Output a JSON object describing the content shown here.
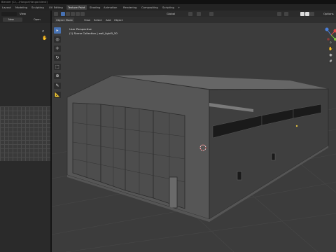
{
  "titlebar": {
    "text": "Blender [C:\\...\\Hangar\\Hangar.blend]"
  },
  "menubar": {
    "left_items": [
      "Layout",
      "Modeling",
      "Sculpting",
      "UV Editing",
      "Texture Paint",
      "Shading",
      "Animation",
      "Rendering",
      "Compositing",
      "Scripting"
    ],
    "active_index": 4,
    "add_tab_label": "+"
  },
  "left_panel": {
    "mode_value": "View",
    "image_label": "New",
    "open_label": "Open"
  },
  "viewport": {
    "mode_label": "Object Mode",
    "menu": [
      "View",
      "Select",
      "Add",
      "Object"
    ],
    "transform_orientation": "Global",
    "perspective_label": "User Perspective",
    "collection_label": "(1) Scene Collection | wall_light5_50",
    "options_label": "Options"
  },
  "colors": {
    "active_tab": "#3e3e3e",
    "tool_active": "#4772b3",
    "axis_x": "#d94a4a",
    "axis_y": "#7bc043",
    "axis_z": "#4a7fd9"
  },
  "icons": [
    "select-box-icon",
    "cursor-icon",
    "move-icon",
    "rotate-icon",
    "scale-icon",
    "transform-icon",
    "annotate-icon",
    "measure-icon",
    "zoom-icon",
    "hand-icon",
    "camera-icon",
    "grid-icon",
    "3d-cursor-icon"
  ]
}
